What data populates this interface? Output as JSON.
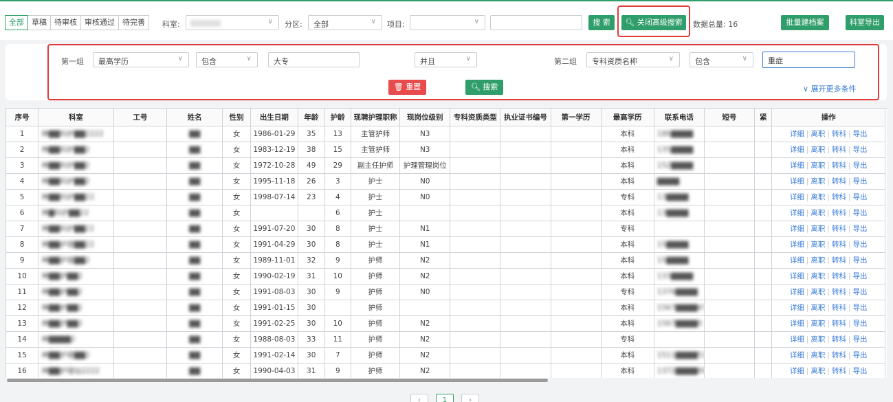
{
  "status_tabs": [
    "全部",
    "草稿",
    "待审核",
    "审核通过",
    "待完善"
  ],
  "filters": {
    "department_label": "科室:",
    "department_value": "",
    "district_label": "分区:",
    "district_value": "全部",
    "project_label": "项目:",
    "project_value": "",
    "search_button": "搜 索",
    "close_advanced_button": "关闭高级搜索",
    "total_label": "数据总量: 16",
    "batch_button": "批量建档案",
    "export_button": "科室导出"
  },
  "advanced": {
    "group1_label": "第一组",
    "group1_field": "最高学历",
    "group1_op": "包含",
    "group1_value": "大专",
    "logic": "并且",
    "group2_label": "第二组",
    "group2_field": "专科资质名称",
    "group2_op": "包含",
    "group2_value": "重症",
    "reset_button": "重置",
    "search_button": "搜索",
    "expand_link": "展开更多条件"
  },
  "table": {
    "columns": [
      "序号",
      "科室",
      "工号",
      "姓名",
      "性别",
      "出生日期",
      "年龄",
      "护龄",
      "现聘护理职称",
      "现岗位级别",
      "专科资质类型",
      "执业证书编号",
      "第一学历",
      "最高学历",
      "联系电话",
      "短号",
      "紧",
      "操作"
    ],
    "ops": [
      "详细",
      "离职",
      "转科",
      "导出"
    ],
    "rows": [
      {
        "no": "1",
        "dept": "神▇▇科护▇▇2222",
        "gender": "女",
        "birth": "1986-01-29",
        "age": "35",
        "nage": "13",
        "title": "主管护师",
        "level": "N3",
        "edu": "本科",
        "phone": "186▇▇▇▇"
      },
      {
        "no": "2",
        "dept": "神▇▇科护▇▇2",
        "gender": "女",
        "birth": "1983-12-19",
        "age": "38",
        "nage": "15",
        "title": "主管护师",
        "level": "N3",
        "edu": "本科",
        "phone": "135▇▇▇▇"
      },
      {
        "no": "3",
        "dept": "神▇▇科护▇▇2",
        "gender": "女",
        "birth": "1972-10-28",
        "age": "49",
        "nage": "29",
        "title": "副主任护师",
        "level": "护理管理岗位",
        "edu": "本科",
        "phone": "152▇▇▇▇"
      },
      {
        "no": "4",
        "dept": "神▇▇科护▇▇2",
        "gender": "女",
        "birth": "1995-11-18",
        "age": "26",
        "nage": "3",
        "title": "护士",
        "level": "N0",
        "edu": "本科",
        "phone": "▇▇▇▇"
      },
      {
        "no": "5",
        "dept": "神▇▇科护▇▇22",
        "gender": "女",
        "birth": "1998-07-14",
        "age": "23",
        "nage": "4",
        "title": "护士",
        "level": "N0",
        "edu": "专科",
        "phone": "13▇▇▇▇"
      },
      {
        "no": "6",
        "dept": "神▇科护▇▇22",
        "gender": "女",
        "birth": "",
        "age": "",
        "nage": "6",
        "title": "护士",
        "level": "",
        "edu": "本科",
        "phone": "13▇▇▇▇"
      },
      {
        "no": "7",
        "dept": "神▇▇科护▇▇22",
        "gender": "女",
        "birth": "1991-07-20",
        "age": "30",
        "nage": "8",
        "title": "护士",
        "level": "N1",
        "edu": "专科",
        "phone": ""
      },
      {
        "no": "8",
        "dept": "神▇▇护理▇▇22",
        "gender": "女",
        "birth": "1991-04-29",
        "age": "30",
        "nage": "8",
        "title": "护士",
        "level": "N1",
        "edu": "本科",
        "phone": "15▇▇▇▇"
      },
      {
        "no": "9",
        "dept": "神▇▇护理▇▇2",
        "gender": "女",
        "birth": "1989-11-01",
        "age": "32",
        "nage": "9",
        "title": "护师",
        "level": "N2",
        "edu": "本科",
        "phone": "15▇▇▇▇"
      },
      {
        "no": "10",
        "dept": "神▇▇护▇▇2",
        "gender": "女",
        "birth": "1990-02-19",
        "age": "31",
        "nage": "10",
        "title": "护师",
        "level": "N2",
        "edu": "本科",
        "phone": "133▇▇▇▇"
      },
      {
        "no": "11",
        "dept": "神▇▇护▇▇2",
        "gender": "女",
        "birth": "1991-08-03",
        "age": "30",
        "nage": "9",
        "title": "护师",
        "level": "N0",
        "edu": "专科",
        "phone": "1376▇▇▇▇"
      },
      {
        "no": "12",
        "dept": "神▇▇护▇▇2",
        "gender": "女",
        "birth": "1991-01-15",
        "age": "30",
        "nage": "",
        "title": "护师",
        "level": "",
        "edu": "本科",
        "phone": "1567▇▇▇▇47"
      },
      {
        "no": "13",
        "dept": "神▇▇护▇▇2",
        "gender": "女",
        "birth": "1991-02-25",
        "age": "30",
        "nage": "10",
        "title": "护师",
        "level": "N2",
        "edu": "本科",
        "phone": "1567▇▇▇▇0"
      },
      {
        "no": "14",
        "dept": "神▇▇▇▇2",
        "gender": "女",
        "birth": "1988-08-03",
        "age": "33",
        "nage": "11",
        "title": "护师",
        "level": "N2",
        "edu": "专科",
        "phone": ""
      },
      {
        "no": "15",
        "dept": "神▇▇护理▇▇2",
        "gender": "女",
        "birth": "1991-02-14",
        "age": "30",
        "nage": "7",
        "title": "护师",
        "level": "N2",
        "edu": "本科",
        "phone": "1511▇▇▇▇51"
      },
      {
        "no": "16",
        "dept": "神▇▇护理站2222",
        "gender": "女",
        "birth": "1990-04-03",
        "age": "31",
        "nage": "9",
        "title": "护师",
        "level": "N2",
        "edu": "本科",
        "phone": "1372▇▇▇▇898"
      }
    ]
  },
  "colors": {
    "accent": "#2f9e6a",
    "danger": "#e84b4b",
    "link": "#3a7bd5",
    "highlight_box": "#e03a3a"
  }
}
